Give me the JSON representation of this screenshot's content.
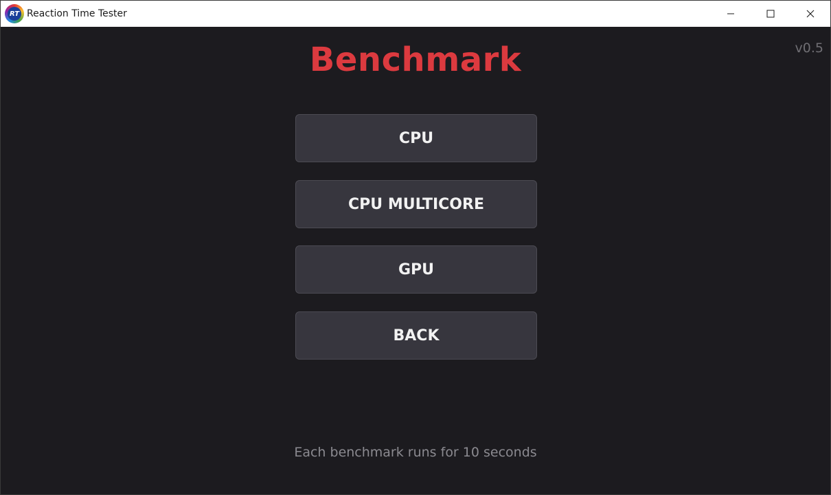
{
  "window": {
    "title": "Reaction Time Tester",
    "logo_text": "RT",
    "controls": [
      "minimize-icon",
      "maximize-icon",
      "close-icon"
    ]
  },
  "version": "v0.5",
  "page": {
    "title": "Benchmark",
    "buttons": [
      {
        "label": "CPU"
      },
      {
        "label": "CPU MULTICORE"
      },
      {
        "label": "GPU"
      },
      {
        "label": "BACK"
      }
    ],
    "footer_note": "Each benchmark runs for 10 seconds"
  },
  "colors": {
    "background": "#1c1b1f",
    "title": "#dc3a3f",
    "button_bg": "#37363e",
    "button_text": "#f2f2f2",
    "muted_text": "#8b8a90"
  }
}
